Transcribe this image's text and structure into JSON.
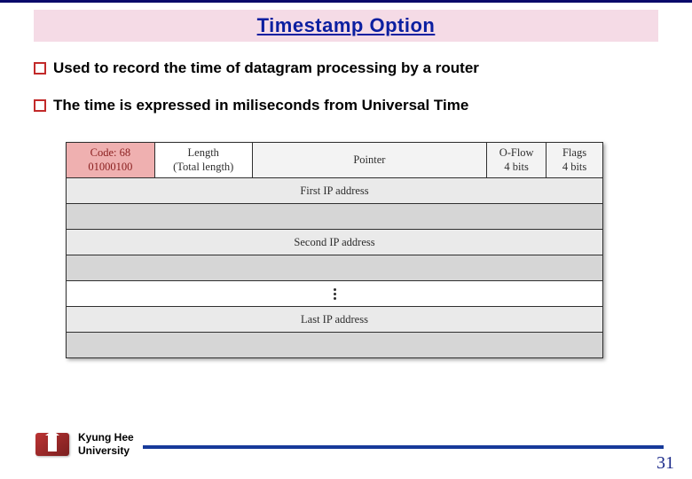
{
  "title": "Timestamp Option",
  "bullets": [
    "Used to record the time of datagram processing by a router",
    "The time is expressed in miliseconds from Universal Time"
  ],
  "diagram": {
    "header": {
      "code": {
        "line1": "Code: 68",
        "line2": "01000100"
      },
      "length": {
        "line1": "Length",
        "line2": "(Total length)"
      },
      "pointer": "Pointer",
      "oflow": {
        "line1": "O-Flow",
        "line2": "4 bits"
      },
      "flags": {
        "line1": "Flags",
        "line2": "4 bits"
      }
    },
    "rows": {
      "first_ip": "First IP address",
      "second_ip": "Second IP address",
      "last_ip": "Last IP address"
    }
  },
  "footer": {
    "university_line1": "Kyung Hee",
    "university_line2": "University"
  },
  "page_number": "31"
}
